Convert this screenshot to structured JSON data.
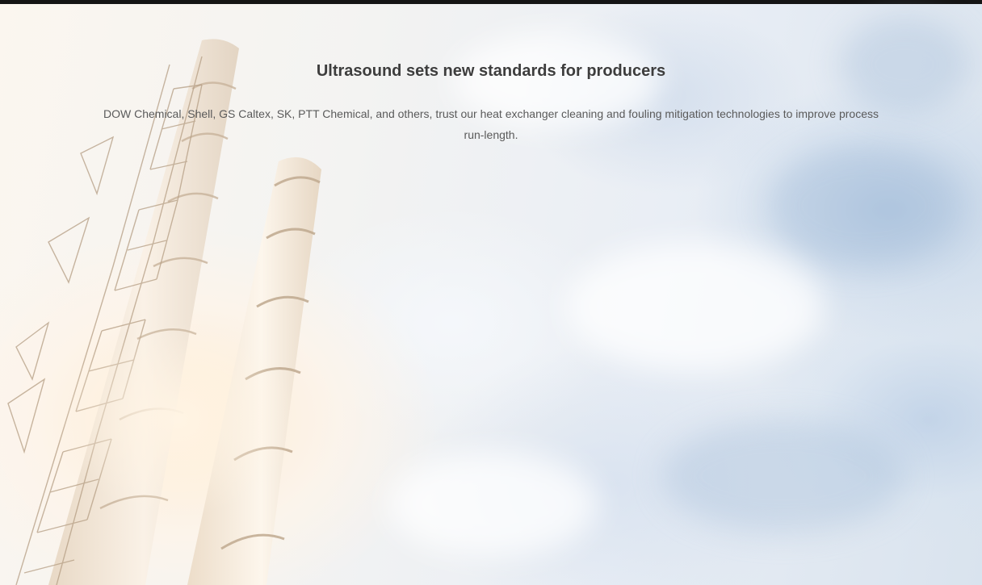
{
  "hero": {
    "title": "Ultrasound sets new standards for producers",
    "description": "DOW Chemical, Shell, GS Caltex, SK, PTT Chemical, and others, trust our heat exchanger cleaning and fouling mitigation technologies to improve process run-length."
  },
  "colors": {
    "top_bar": "#141414",
    "title_text": "#3d3d3d",
    "body_text": "#5a5a5a",
    "sky_blue": "#d9e3ee",
    "glow_warm": "#ffecd2"
  },
  "background": {
    "image_subject": "industrial-smokestacks-against-cloudy-sky"
  }
}
